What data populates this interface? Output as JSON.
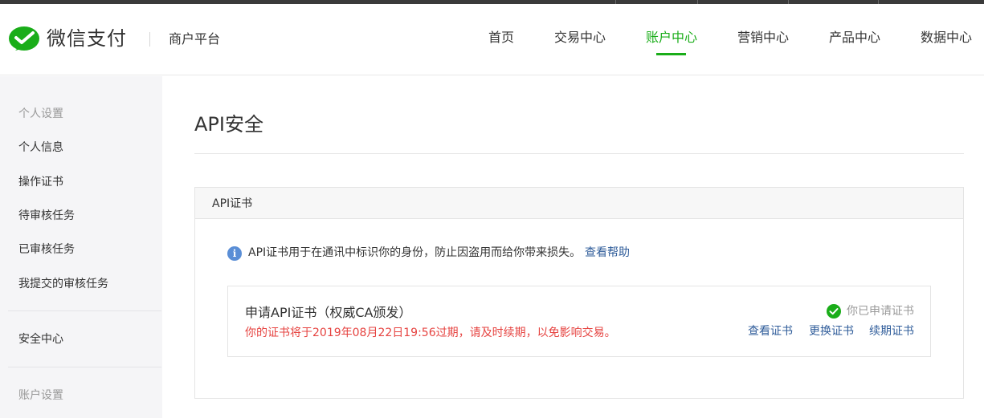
{
  "header": {
    "brand": "微信支付",
    "platform": "商户平台",
    "nav": [
      {
        "label": "首页",
        "active": false
      },
      {
        "label": "交易中心",
        "active": false
      },
      {
        "label": "账户中心",
        "active": true
      },
      {
        "label": "营销中心",
        "active": false
      },
      {
        "label": "产品中心",
        "active": false
      },
      {
        "label": "数据中心",
        "active": false
      }
    ]
  },
  "sidebar": {
    "group_personal": "个人设置",
    "items": [
      "个人信息",
      "操作证书",
      "待审核任务",
      "已审核任务",
      "我提交的审核任务"
    ],
    "security": "安全中心",
    "group_account": "账户设置"
  },
  "main": {
    "title": "API安全",
    "panel": {
      "heading": "API证书",
      "info_text": "API证书用于在通讯中标识你的身份，防止因盗用而给你带来损失。",
      "help_link": "查看帮助",
      "cert": {
        "title": "申请API证书（权威CA颁发）",
        "warning": "你的证书将于2019年08月22日19:56过期，请及时续期，以免影响交易。",
        "status": "你已申请证书",
        "actions": [
          "查看证书",
          "更换证书",
          "续期证书"
        ]
      }
    }
  },
  "colors": {
    "brand_green": "#1aad19",
    "link_blue": "#2f5c9a",
    "warning_red": "#e64340",
    "info_blue": "#5a8ed6"
  },
  "icons": {
    "logo": "wechat-pay-logo-icon",
    "info": "info-icon",
    "status": "check-circle-icon"
  }
}
